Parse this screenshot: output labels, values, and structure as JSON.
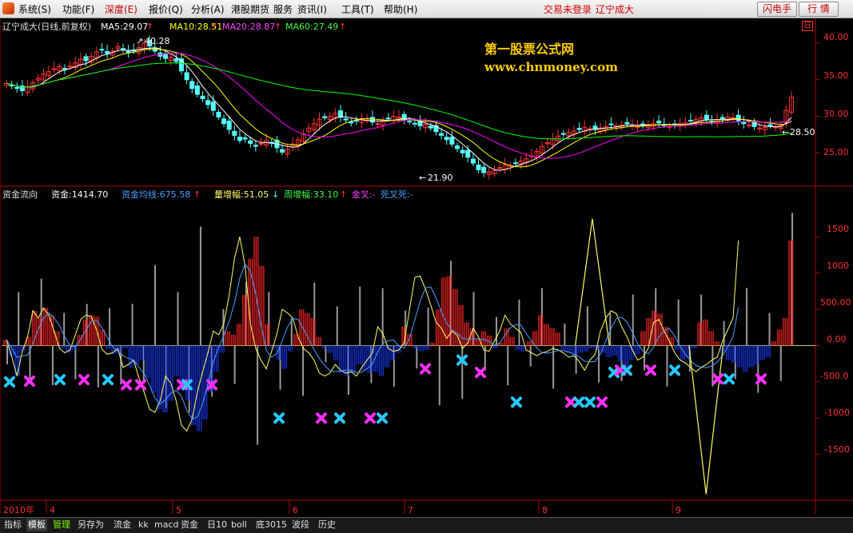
{
  "menubar": {
    "items": [
      "系统(S)",
      "功能(F)",
      "深度(E)",
      "报价(Q)",
      "分析(A)",
      "港股期货",
      "服务",
      "资讯(I)",
      "工具(T)",
      "帮助(H)"
    ],
    "status_text": "交易未登录",
    "stock_name": "辽宁成大",
    "buttons": [
      "闪电手",
      "行 情"
    ]
  },
  "price_panel": {
    "stock_label": "辽宁成大(日线,前复权)",
    "ma5": "MA5:29.07",
    "ma10": "MA10:28.51",
    "ma20": "MA20:28.87",
    "ma60": "MA60:27.49",
    "corner_tag": "日",
    "high_annotation": "40.28",
    "low_annotation": "21.90",
    "last_annotation": "28.50",
    "watermark_cn": "第一股票公式网",
    "watermark_en": "www.chnmoney.com",
    "axis_ticks": [
      "40.00",
      "35.00",
      "30.00",
      "25.00"
    ]
  },
  "indicator_panel": {
    "name": "资金流向",
    "fund": "资金:1414.70",
    "fund_avg": "资金均线:675.58",
    "vol_inc": "量增幅:51.05",
    "week_inc": "周增幅:33.10",
    "golden_cross": "金叉:-",
    "death_cross": "死叉死:-",
    "axis_ticks": [
      "1500",
      "1000",
      "500.00",
      "0.00",
      "-500.0",
      "-1000",
      "-1500"
    ]
  },
  "date_axis": {
    "year_label": "2010年",
    "months": [
      "4",
      "5",
      "6",
      "7",
      "8",
      "9"
    ]
  },
  "bottom_tabs": [
    "指标",
    "模板",
    "管理",
    "另存为",
    "流金",
    "kk",
    "macd",
    "资金",
    "日10",
    "boll",
    "底3015",
    "波段",
    "历史"
  ],
  "colors": {
    "up": "#ff3232",
    "down": "#54ffff",
    "ma5": "#ffffff",
    "ma10": "#ffff00",
    "ma20": "#ff00ff",
    "ma60": "#00ff00",
    "fund_up": "#e02020",
    "fund_down": "#1530d0",
    "fund_line": "#ffff66",
    "fund_avg_line": "#4aa0ff",
    "vol_bar": "#9a9a9a",
    "cross_cyan": "#28c8ff",
    "cross_magenta": "#ff30ff"
  },
  "chart_data": [
    {
      "type": "candlestick",
      "title": "辽宁成大(日线,前复权)",
      "ylim": [
        21.0,
        42.5
      ],
      "y_ticks": [
        25,
        30,
        35,
        40
      ],
      "x_labels": [
        "2010年",
        "4",
        "5",
        "6",
        "7",
        "8",
        "9"
      ],
      "close_approx": [
        34.5,
        34.2,
        33.8,
        33.5,
        34.0,
        34.6,
        35.2,
        35.8,
        36.1,
        36.5,
        36.8,
        36.4,
        36.9,
        37.3,
        37.8,
        37.6,
        38.2,
        38.8,
        39.1,
        38.6,
        38.9,
        39.5,
        39.2,
        38.7,
        38.9,
        39.4,
        40.0,
        39.6,
        38.9,
        38.2,
        37.9,
        38.1,
        37.5,
        36.2,
        35.0,
        33.8,
        33.0,
        32.4,
        31.6,
        30.8,
        29.9,
        29.0,
        28.2,
        27.4,
        26.7,
        26.9,
        26.3,
        25.9,
        26.3,
        26.7,
        26.4,
        25.7,
        25.1,
        25.5,
        26.2,
        26.8,
        27.6,
        28.4,
        29.0,
        29.6,
        29.8,
        30.0,
        30.4,
        29.9,
        29.5,
        29.1,
        29.4,
        29.7,
        29.5,
        29.2,
        29.0,
        29.4,
        29.7,
        30.0,
        29.9,
        29.6,
        29.3,
        29.0,
        28.7,
        28.9,
        28.4,
        27.9,
        27.4,
        26.8,
        26.2,
        25.6,
        25.0,
        24.4,
        23.6,
        22.7,
        22.3,
        22.4,
        22.6,
        23.0,
        23.4,
        23.3,
        23.6,
        23.9,
        24.2,
        24.6,
        25.2,
        25.9,
        26.4,
        26.9,
        27.3,
        27.6,
        27.8,
        28.0,
        28.2,
        28.5,
        28.3,
        28.2,
        28.4,
        28.6,
        28.9,
        28.7,
        28.8,
        29.0,
        28.8,
        28.6,
        28.7,
        28.9,
        29.0,
        29.1,
        28.8,
        28.6,
        28.9,
        29.0,
        29.1,
        29.4,
        29.6,
        29.8,
        29.6,
        29.3,
        29.5,
        29.7,
        29.9,
        29.8,
        29.4,
        29.0,
        28.8,
        28.6,
        28.4,
        28.5,
        28.7,
        28.6,
        28.8,
        30.8,
        32.6
      ],
      "annotations": {
        "high": 40.28,
        "low": 21.9,
        "last": 28.5
      },
      "series": [
        {
          "name": "MA5",
          "last": 29.07
        },
        {
          "name": "MA10",
          "last": 28.51
        },
        {
          "name": "MA20",
          "last": 28.87
        },
        {
          "name": "MA60",
          "last": 27.49
        }
      ]
    },
    {
      "type": "bar",
      "title": "资金流向",
      "ylim": [
        -2100,
        2000
      ],
      "y_ticks": [
        1500,
        1000,
        500,
        0,
        -500,
        -1000,
        -1500
      ],
      "fund_approx": [
        80,
        -150,
        -420,
        -80,
        120,
        480,
        380,
        520,
        420,
        200,
        -40,
        -100,
        -60,
        150,
        360,
        420,
        400,
        220,
        -50,
        -120,
        -100,
        -40,
        -300,
        -260,
        -200,
        -450,
        -650,
        -880,
        -920,
        -760,
        -420,
        -520,
        -760,
        -1100,
        -1180,
        -1020,
        -640,
        -360,
        -100,
        200,
        150,
        300,
        700,
        1200,
        1500,
        1100,
        300,
        -40,
        -200,
        -320,
        -80,
        160,
        500,
        450,
        380,
        120,
        -40,
        -100,
        -200,
        -380,
        -420,
        -380,
        -260,
        -340,
        -380,
        -360,
        -420,
        -300,
        -200,
        -100,
        260,
        160,
        -40,
        -80,
        -60,
        40,
        500,
        940,
        960,
        780,
        560,
        320,
        240,
        100,
        200,
        140,
        -40,
        40,
        240,
        120,
        -60,
        -80,
        60,
        200,
        420,
        300,
        240,
        180,
        -60,
        -100,
        -140,
        -100,
        -80,
        -40,
        -60,
        -100,
        -160,
        -140,
        -220,
        -340,
        -200,
        -120,
        200,
        380,
        480,
        440,
        260,
        120,
        -60,
        -200,
        -160,
        -40,
        320,
        360,
        200,
        60,
        -100,
        -200,
        -240,
        -300,
        -360,
        -300,
        -260,
        -200,
        -160,
        60,
        220,
        380,
        1450
      ]
    }
  ]
}
